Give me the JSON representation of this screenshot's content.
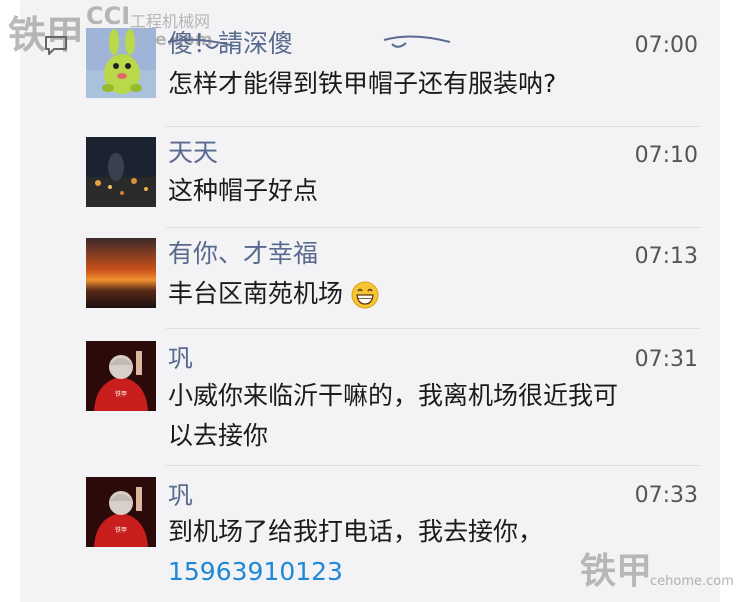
{
  "watermark": {
    "brand": "铁甲",
    "site_prefix": "CCI",
    "site_name": "工程机械网",
    "url": "cehome.com"
  },
  "comments": [
    {
      "name": "傻！請深傻",
      "time": "07:00",
      "text": "怎样才能得到铁甲帽子还有服装呐?"
    },
    {
      "name": "天天",
      "time": "07:10",
      "text": "这种帽子好点"
    },
    {
      "name": "有你、才幸福",
      "time": "07:13",
      "text": "丰台区南苑机场",
      "emoji": "grinning-face-emoji"
    },
    {
      "name": "巩",
      "time": "07:31",
      "text_line1": "小威你来临沂干嘛的，我离机场很近我可",
      "text_line2": "以去接你"
    },
    {
      "name": "巩",
      "time": "07:33",
      "text_line1": "到机场了给我打电话，我去接你，",
      "phone": "15963910123"
    }
  ]
}
